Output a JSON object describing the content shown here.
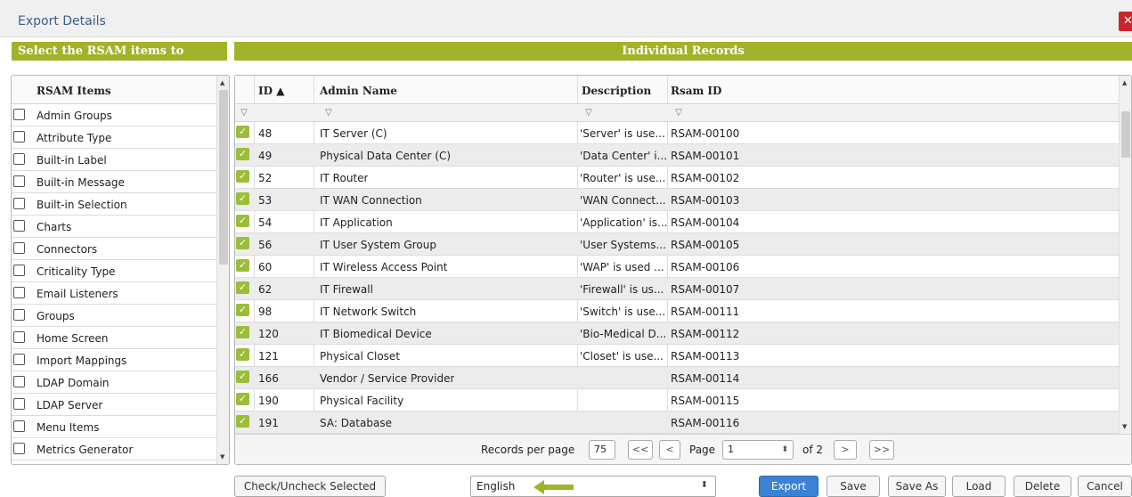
{
  "window": {
    "title": "Export Details",
    "close_icon": "close-icon"
  },
  "left_section": {
    "header": "Select the RSAM items to Export",
    "column": "RSAM Items",
    "items": [
      "Admin Groups",
      "Attribute Type",
      "Built-in Label",
      "Built-in Message",
      "Built-in Selection",
      "Charts",
      "Connectors",
      "Criticality Type",
      "Email Listeners",
      "Groups",
      "Home Screen",
      "Import Mappings",
      "LDAP Domain",
      "LDAP Server",
      "Menu Items",
      "Metrics Generator"
    ]
  },
  "right_section": {
    "header": "Individual Records",
    "columns": {
      "id": "ID ▲",
      "admin_name": "Admin Name",
      "description": "Description",
      "rsam_id": "Rsam ID"
    },
    "rows": [
      {
        "id": "48",
        "admin_name": "IT Server (C)",
        "description": "'Server' is use...",
        "rsam_id": "RSAM-00100",
        "checked": true
      },
      {
        "id": "49",
        "admin_name": "Physical Data Center (C)",
        "description": "'Data Center' i...",
        "rsam_id": "RSAM-00101",
        "checked": true
      },
      {
        "id": "52",
        "admin_name": "IT Router",
        "description": "'Router' is use...",
        "rsam_id": "RSAM-00102",
        "checked": true
      },
      {
        "id": "53",
        "admin_name": "IT WAN Connection",
        "description": "'WAN Connect...",
        "rsam_id": "RSAM-00103",
        "checked": true
      },
      {
        "id": "54",
        "admin_name": "IT Application",
        "description": "'Application' is...",
        "rsam_id": "RSAM-00104",
        "checked": true
      },
      {
        "id": "56",
        "admin_name": "IT User System Group",
        "description": "'User Systems...",
        "rsam_id": "RSAM-00105",
        "checked": true
      },
      {
        "id": "60",
        "admin_name": "IT Wireless Access Point",
        "description": "'WAP' is used ...",
        "rsam_id": "RSAM-00106",
        "checked": true
      },
      {
        "id": "62",
        "admin_name": "IT Firewall",
        "description": "'Firewall' is us...",
        "rsam_id": "RSAM-00107",
        "checked": true
      },
      {
        "id": "98",
        "admin_name": "IT Network Switch",
        "description": "'Switch' is use...",
        "rsam_id": "RSAM-00111",
        "checked": true
      },
      {
        "id": "120",
        "admin_name": "IT Biomedical Device",
        "description": "'Bio-Medical D...",
        "rsam_id": "RSAM-00112",
        "checked": true
      },
      {
        "id": "121",
        "admin_name": "Physical Closet",
        "description": "'Closet' is use...",
        "rsam_id": "RSAM-00113",
        "checked": true
      },
      {
        "id": "166",
        "admin_name": "Vendor / Service Provider",
        "description": "",
        "rsam_id": "RSAM-00114",
        "checked": true
      },
      {
        "id": "190",
        "admin_name": "Physical Facility",
        "description": "",
        "rsam_id": "RSAM-00115",
        "checked": true
      },
      {
        "id": "191",
        "admin_name": "SA: Database",
        "description": "",
        "rsam_id": "RSAM-00116",
        "checked": true
      }
    ]
  },
  "pager": {
    "records_label": "Records per page",
    "records_value": "75",
    "first": "<<",
    "prev": "<",
    "page_label": "Page",
    "page_value": "1",
    "of_label": "of 2",
    "next": ">",
    "last": ">>"
  },
  "footer": {
    "check_uncheck": "Check/Uncheck Selected",
    "language": "English",
    "export": "Export",
    "save": "Save",
    "save_as": "Save As",
    "load": "Load",
    "delete": "Delete",
    "cancel": "Cancel"
  },
  "colors": {
    "accent_green": "#a2b229",
    "check_green": "#9bbd3a",
    "primary_blue": "#3b82d6",
    "close_red": "#c9252c"
  }
}
